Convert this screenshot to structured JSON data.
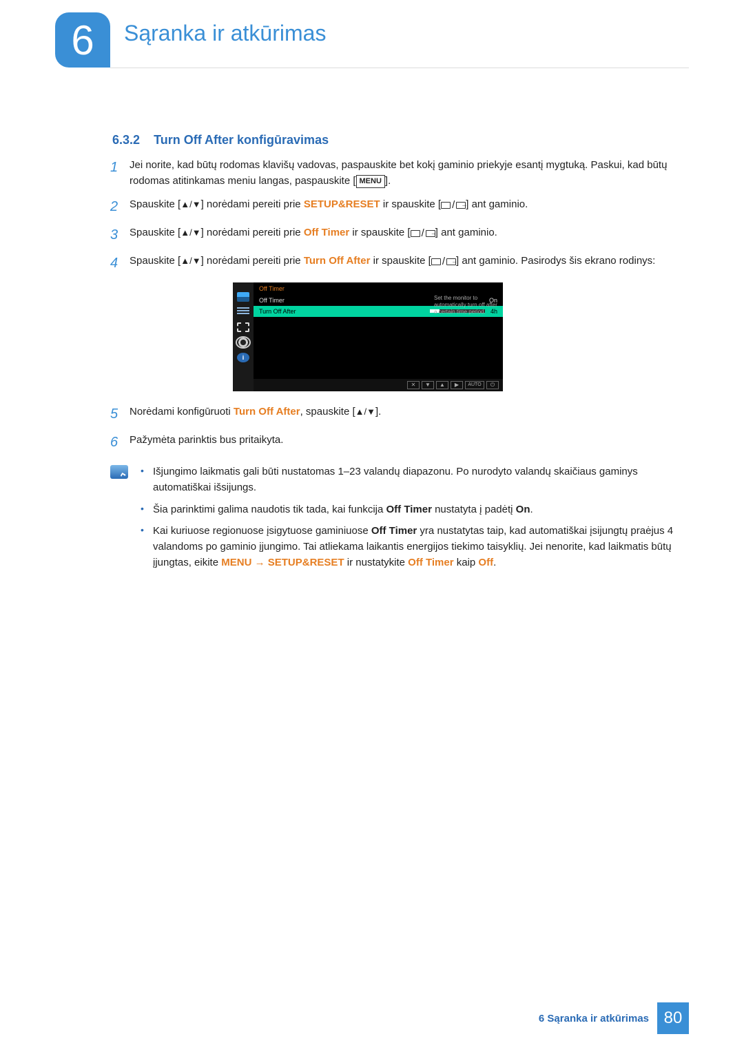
{
  "chapter": {
    "number": "6",
    "title": "Sąranka ir atkūrimas"
  },
  "section": {
    "number": "6.3.2",
    "title": "Turn Off After konfigūravimas"
  },
  "steps": {
    "s1": {
      "n": "1",
      "text_a": "Jei norite, kad būtų rodomas klavišų vadovas, paspauskite bet kokį gaminio priekyje esantį mygtuką. Paskui, kad būtų rodomas atitinkamas meniu langas, paspauskite [",
      "menu": "MENU",
      "text_b": "]."
    },
    "s2": {
      "n": "2",
      "pre": "Spauskite [",
      "mid": "] norėdami pereiti prie ",
      "kw": "SETUP&RESET",
      "post1": " ir spauskite [",
      "post2": "] ant gaminio."
    },
    "s3": {
      "n": "3",
      "pre": "Spauskite [",
      "mid": "] norėdami pereiti prie ",
      "kw": "Off Timer",
      "post1": " ir spauskite [",
      "post2": "] ant gaminio."
    },
    "s4": {
      "n": "4",
      "pre": "Spauskite [",
      "mid": "] norėdami pereiti prie ",
      "kw": "Turn Off After",
      "post1": " ir spauskite [",
      "post2": "] ant gaminio. Pasirodys šis ekrano rodinys:"
    },
    "s5": {
      "n": "5",
      "pre": "Norėdami konfigūruoti ",
      "kw": "Turn Off After",
      "mid": ", spauskite [",
      "post": "]."
    },
    "s6": {
      "n": "6",
      "text": "Pažymėta parinktis bus pritaikyta."
    }
  },
  "osd": {
    "header": "Off Timer",
    "row1_label": "Off Timer",
    "row1_val": "On",
    "row2_label": "Turn Off After",
    "row2_val": "4h",
    "help": "Set the monitor to automatically turn off after a certain time period.",
    "footer_auto": "AUTO"
  },
  "notes": {
    "n1": "Išjungimo laikmatis gali būti nustatomas 1–23 valandų diapazonu. Po nurodyto valandų skaičiaus gaminys automatiškai išsijungs.",
    "n2_a": "Šia parinktimi galima naudotis tik tada, kai funkcija ",
    "n2_kw1": "Off Timer",
    "n2_b": " nustatyta į padėtį ",
    "n2_kw2": "On",
    "n2_c": ".",
    "n3_a": "Kai kuriuose regionuose įsigytuose gaminiuose ",
    "n3_kw1": "Off Timer",
    "n3_b": " yra nustatytas taip, kad automatiškai įsijungtų praėjus 4 valandoms po gaminio įjungimo. Tai atliekama laikantis energijos tiekimo taisyklių. Jei nenorite, kad laikmatis būtų įjungtas, eikite ",
    "n3_kw2": "MENU",
    "n3_arrow": " → ",
    "n3_kw3": "SETUP&RESET",
    "n3_c": " ir nustatykite ",
    "n3_kw4": "Off Timer",
    "n3_d": " kaip ",
    "n3_kw5": "Off",
    "n3_e": "."
  },
  "footer": {
    "text": "6 Sąranka ir atkūrimas",
    "page": "80"
  }
}
